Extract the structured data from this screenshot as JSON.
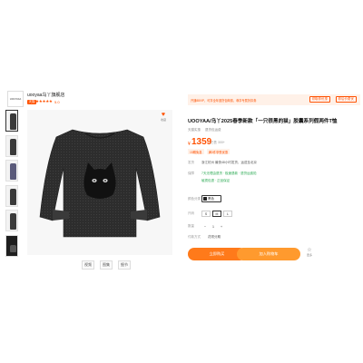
{
  "store": {
    "logo": "UOOYAA",
    "name": "uooyaa乌丫旗舰店",
    "tag": "天猫",
    "stars": "★★★★★",
    "rating": "5.0"
  },
  "gallery": {
    "thumb_count": 6,
    "selected_index": 0,
    "actions": [
      "视频",
      "图集",
      "细节"
    ]
  },
  "favorite": {
    "label": "收藏"
  },
  "promo": {
    "text": "开通88VIP，可享全年退货包邮费，尊享专属折扣券",
    "btn1": "领取券优惠",
    "btn2": "券后价更优"
  },
  "product": {
    "title": "UOOYAA/乌丫2025春季新款「一只很黑的猫」胶囊系列假两件T恤",
    "tags": [
      "天猫实惠",
      "退货包运费"
    ],
    "currency": "¥",
    "price": "1359",
    "sold": "已售 300+",
    "ribbons": [
      "15期免息",
      "满3件享受优惠"
    ]
  },
  "rows": {
    "shipping_label": "发货",
    "shipping_value": "浙江杭州 最快48小时发货，运送至北京",
    "service_label": "保障",
    "service_value": "7天无理由退货 · 极速退款 · 退货运费险",
    "service_more": "破损包退 · 正品保证",
    "color_label": "颜色分类",
    "color_value": "黑色",
    "size_label": "尺码",
    "sizes": [
      "S",
      "M",
      "L"
    ],
    "qty_label": "数量",
    "qty_minus": "−",
    "qty_value": "1",
    "qty_plus": "+",
    "pay_label": "付款方式",
    "pay_value": "花呗分期"
  },
  "buttons": {
    "buy": "立即购买",
    "cart": "加入购物车",
    "more": "更多"
  },
  "colors": {
    "accent": "#ff5000",
    "buy": "#ff7a1a",
    "cart": "#ff9a2e"
  }
}
